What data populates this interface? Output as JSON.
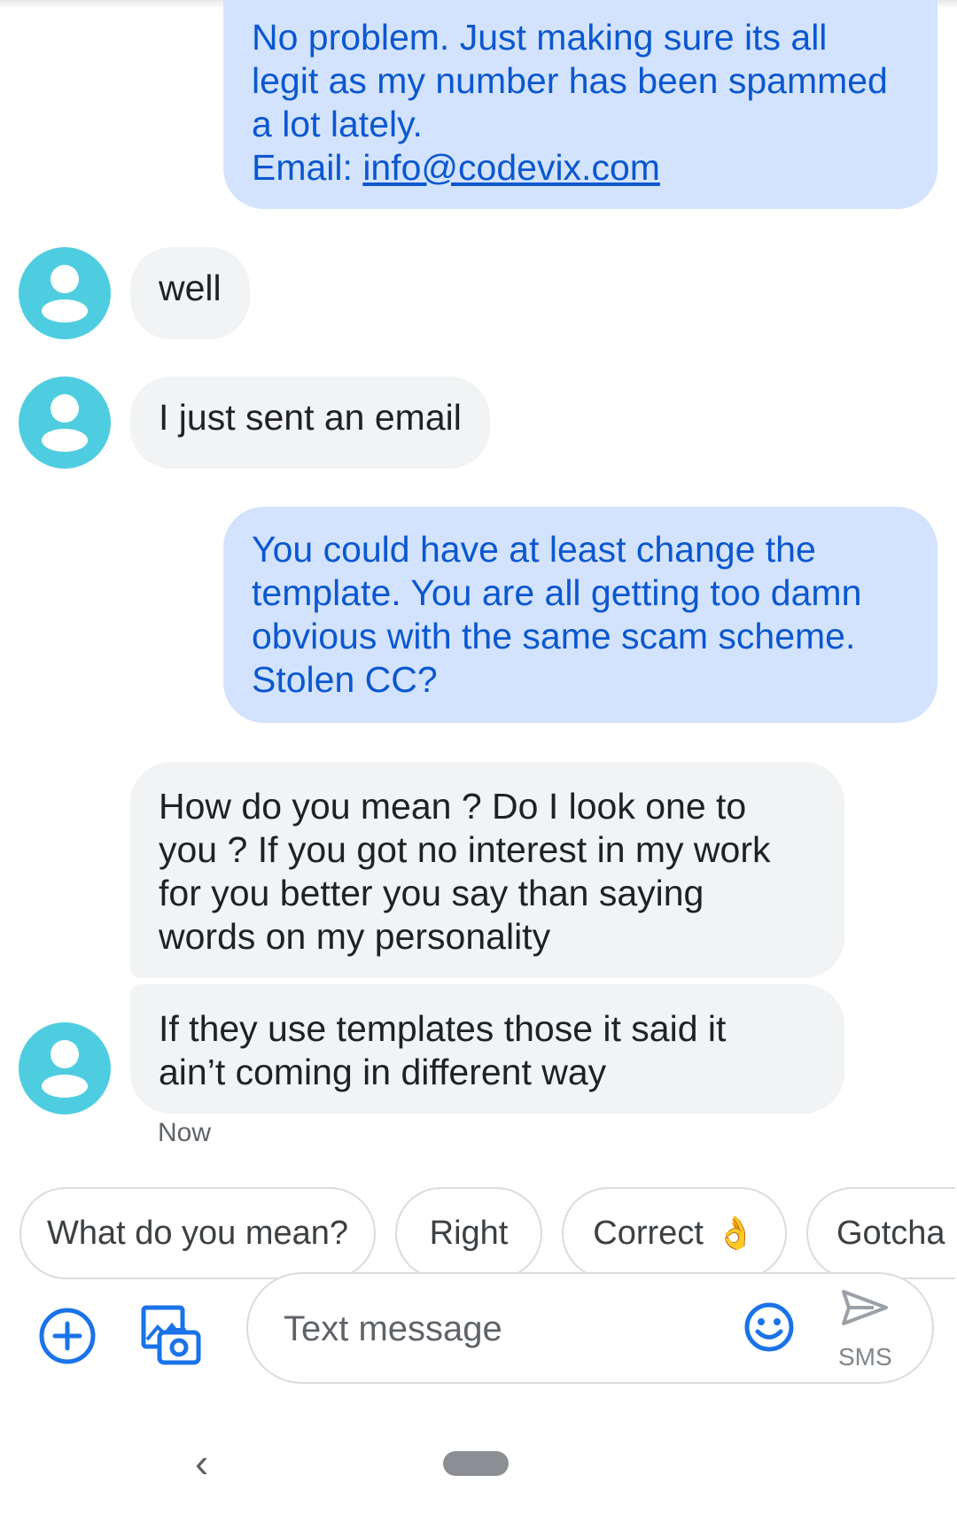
{
  "conversation": {
    "msg1": {
      "lines": [
        "No problem. Just making sure its all",
        "legit as my number has been spammed",
        "a lot lately."
      ],
      "email_prefix": "Email: ",
      "email_link": "info@codevix.com"
    },
    "msg2": {
      "text": "well"
    },
    "msg3": {
      "text": "I just sent an email"
    },
    "msg4": {
      "lines": [
        "You could have at least change the",
        "template. You are all getting too damn",
        "obvious with the same scam scheme.",
        "Stolen CC?"
      ]
    },
    "msg5": {
      "lines": [
        "How do you mean ? Do I look one to",
        "you ? If you got no interest in my work",
        "for you better you say than saying",
        "words on my personality"
      ]
    },
    "msg6": {
      "lines": [
        "If they use templates those it said it",
        "ain’t coming in different way"
      ]
    },
    "timestamp": "Now"
  },
  "smart_replies": [
    {
      "label": "What do you mean?"
    },
    {
      "label": "Right"
    },
    {
      "label": "Correct",
      "emoji": "👌"
    },
    {
      "label": "Gotcha"
    }
  ],
  "composer": {
    "placeholder": "Text message",
    "send_label": "SMS"
  },
  "icons": {
    "add": "add-circle-icon",
    "gallery": "gallery-camera-icon",
    "emoji": "emoji-smiley-icon",
    "send": "send-icon",
    "avatar": "person-icon",
    "back": "nav-back-icon"
  },
  "colors": {
    "outgoing_bubble": "#d3e3fd",
    "outgoing_text": "#0b57d0",
    "incoming_bubble": "#f1f3f4",
    "avatar": "#4fcde0",
    "accent": "#1a73e8"
  },
  "nav": {
    "back_glyph": "‹"
  }
}
